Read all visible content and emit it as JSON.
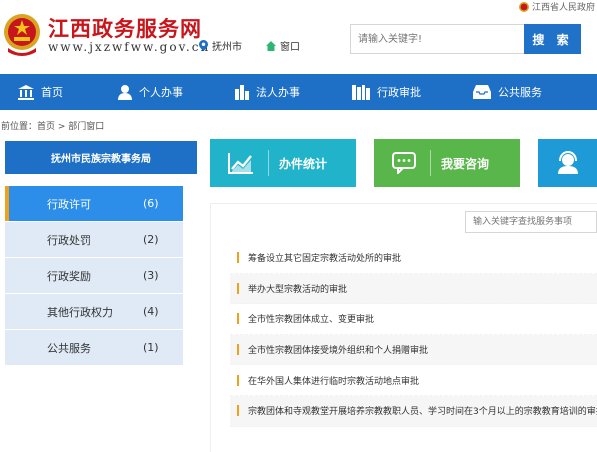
{
  "header": {
    "site_title": "江西政务服务网",
    "site_url": "www.jxzwfww.gov.cn",
    "location_label": "抚州市",
    "window_label": "窗口",
    "gov_link": "江西省人民政府",
    "search_placeholder": "请输入关键字!",
    "search_button": "搜 索"
  },
  "nav": {
    "items": [
      {
        "label": "首页",
        "icon": "bank-icon"
      },
      {
        "label": "个人办事",
        "icon": "person-icon"
      },
      {
        "label": "法人办事",
        "icon": "building-icon"
      },
      {
        "label": "行政审批",
        "icon": "books-icon"
      },
      {
        "label": "公共服务",
        "icon": "inbox-icon"
      }
    ]
  },
  "breadcrumb": {
    "prefix": "前位置：",
    "home": "首页",
    "separator": " > ",
    "current": "部门窗口"
  },
  "sidebar": {
    "department": "抚州市民族宗教事务局",
    "items": [
      {
        "label": "行政许可",
        "count": "(6)",
        "active": true
      },
      {
        "label": "行政处罚",
        "count": "(2)",
        "active": false
      },
      {
        "label": "行政奖励",
        "count": "(3)",
        "active": false
      },
      {
        "label": "其他行政权力",
        "count": "(4)",
        "active": false
      },
      {
        "label": "公共服务",
        "count": "(1)",
        "active": false
      }
    ]
  },
  "tiles": {
    "stats_label": "办件统计",
    "consult_label": "我要咨询"
  },
  "content": {
    "filter_placeholder": "输入关键字查找服务事项",
    "items": [
      "筹备设立其它固定宗教活动处所的审批",
      "举办大型宗教活动的审批",
      "全市性宗教团体成立、变更审批",
      "全市性宗教团体接受境外组织和个人捐赠审批",
      "在华外国人集体进行临时宗教活动地点审批",
      "宗教团体和寺观教堂开展培养宗教教职人员、学习时间在3个月以上的宗教教育培训的审批"
    ]
  },
  "colors": {
    "brand_red": "#c8161d",
    "nav_blue": "#1e6fc6",
    "active_blue": "#2c8ee8",
    "accent_orange": "#f0a11b",
    "teal": "#21b3c9",
    "green": "#59b64a"
  }
}
